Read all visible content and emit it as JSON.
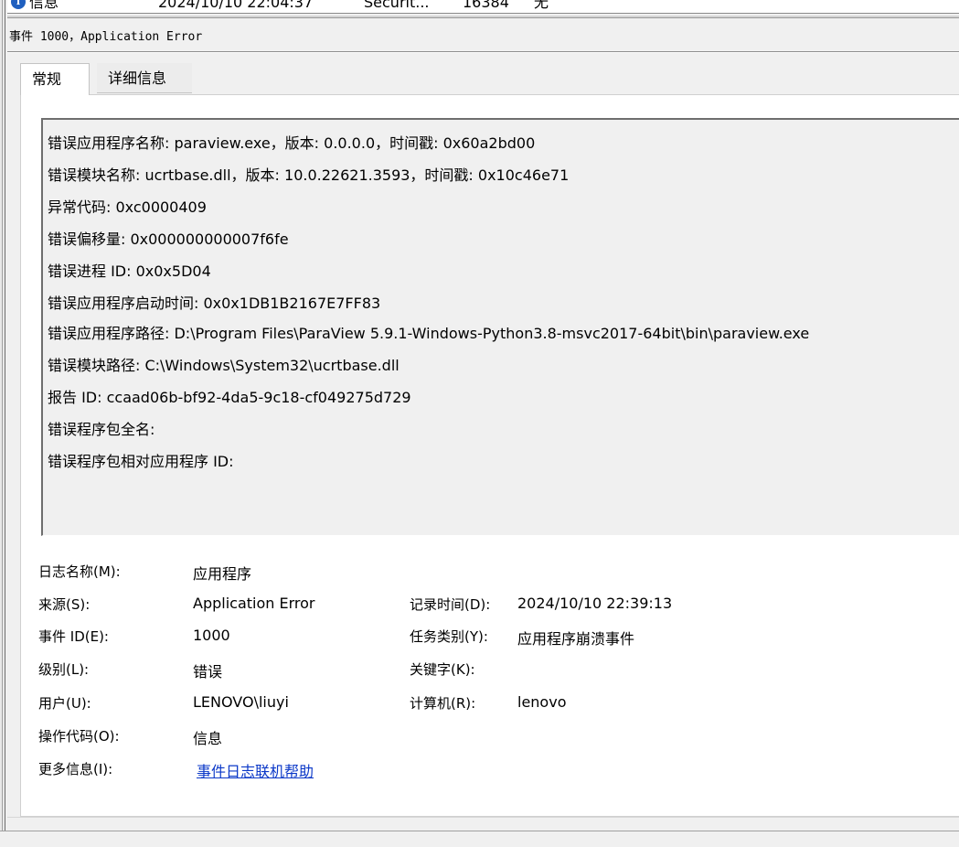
{
  "top_row": {
    "level": "信息",
    "datetime": "2024/10/10 22:04:37",
    "source": "Securit...",
    "event_id": "16384",
    "task": "无"
  },
  "event_title": "事件 1000，Application Error",
  "tabs": {
    "general": "常规",
    "details": "详细信息"
  },
  "description_lines": [
    "错误应用程序名称: paraview.exe，版本: 0.0.0.0，时间戳: 0x60a2bd00",
    "错误模块名称: ucrtbase.dll，版本: 10.0.22621.3593，时间戳: 0x10c46e71",
    "异常代码: 0xc0000409",
    "错误偏移量: 0x000000000007f6fe",
    "错误进程 ID: 0x0x5D04",
    "错误应用程序启动时间: 0x0x1DB1B2167E7FF83",
    "错误应用程序路径: D:\\Program Files\\ParaView 5.9.1-Windows-Python3.8-msvc2017-64bit\\bin\\paraview.exe",
    "错误模块路径: C:\\Windows\\System32\\ucrtbase.dll",
    "报告 ID: ccaad06b-bf92-4da5-9c18-cf049275d729",
    "错误程序包全名:",
    "错误程序包相对应用程序 ID:"
  ],
  "properties": {
    "log_name_label": "日志名称(M):",
    "log_name_value": "应用程序",
    "source_label": "来源(S):",
    "source_value": "Application Error",
    "logged_label": "记录时间(D):",
    "logged_value": "2024/10/10 22:39:13",
    "event_id_label": "事件 ID(E):",
    "event_id_value": "1000",
    "task_category_label": "任务类别(Y):",
    "task_category_value": "应用程序崩溃事件",
    "level_label": "级别(L):",
    "level_value": "错误",
    "keywords_label": "关键字(K):",
    "keywords_value": "",
    "user_label": "用户(U):",
    "user_value": "LENOVO\\liuyi",
    "computer_label": "计算机(R):",
    "computer_value": "lenovo",
    "opcode_label": "操作代码(O):",
    "opcode_value": "信息",
    "more_info_label": "更多信息(I):",
    "more_info_link": "事件日志联机帮助"
  },
  "colors": {
    "link": "#0b38c8",
    "info_icon": "#1f5fbf"
  }
}
